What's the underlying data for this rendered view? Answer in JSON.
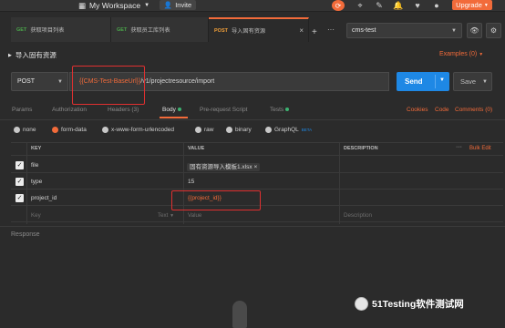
{
  "topbar": {
    "workspace": "My Workspace",
    "invite": "Invite",
    "upgrade": "Upgrade"
  },
  "tabs": [
    {
      "method": "GET",
      "label": "获取项目列表"
    },
    {
      "method": "GET",
      "label": "获取员工库列表"
    },
    {
      "method": "POST",
      "label": "导入固有资源"
    }
  ],
  "environment": {
    "selected": "cms-test"
  },
  "request": {
    "title": "导入固有资源",
    "examples": "Examples (0)",
    "method": "POST",
    "url_variable": "{{CMS-Test-BaseUrl}}",
    "url_path": "/v1/projectresource/import",
    "send": "Send",
    "save": "Save"
  },
  "subtabs": {
    "params": "Params",
    "authorization": "Authorization",
    "headers": "Headers (3)",
    "body": "Body",
    "prerequest": "Pre-request Script",
    "tests": "Tests",
    "cookies": "Cookies",
    "code": "Code",
    "comments": "Comments (0)"
  },
  "body_types": {
    "none": "none",
    "form_data": "form-data",
    "urlencoded": "x-www-form-urlencoded",
    "raw": "raw",
    "binary": "binary",
    "graphql": "GraphQL",
    "beta": "BETA"
  },
  "table": {
    "headers": {
      "key": "KEY",
      "value": "VALUE",
      "description": "DESCRIPTION"
    },
    "bulk_edit": "Bulk Edit",
    "rows": [
      {
        "key": "file",
        "value": "固有资源导入模板1.xlsx",
        "remove": "×"
      },
      {
        "key": "type",
        "value": "15"
      },
      {
        "key": "project_id",
        "value": "{{project_id}}"
      }
    ],
    "placeholder": {
      "key": "Key",
      "type": "Text",
      "value": "Value",
      "description": "Description"
    }
  },
  "response": {
    "title": "Response"
  },
  "watermark": {
    "text": "51Testing软件测试网"
  },
  "colors": {
    "accent": "#f26b3a",
    "send": "#1e88e5",
    "highlight": "#e03030"
  }
}
